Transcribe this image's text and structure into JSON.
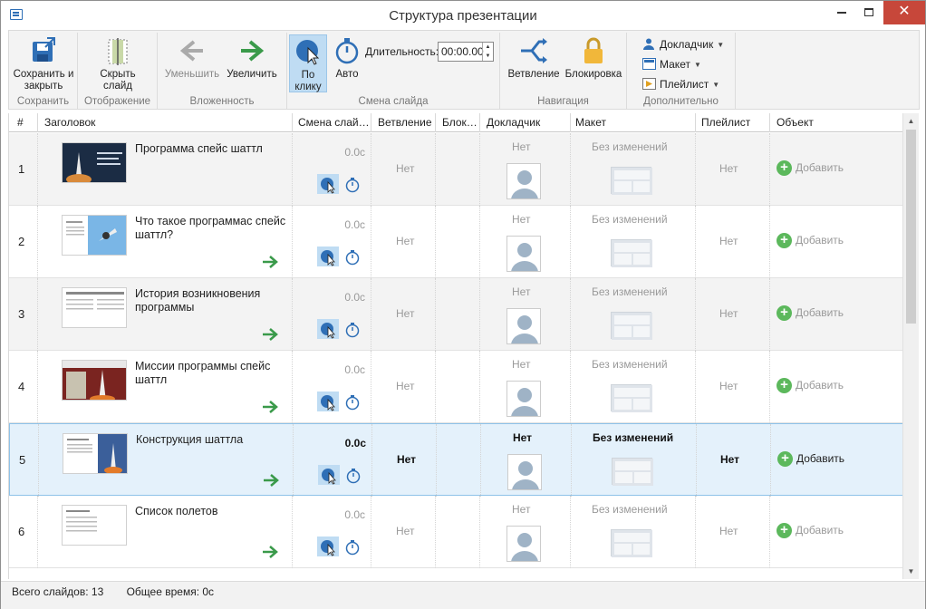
{
  "window": {
    "title": "Структура презентации"
  },
  "ribbon": {
    "groups": [
      {
        "label": "Сохранить",
        "buttons": [
          {
            "label": "Сохранить и закрыть"
          }
        ]
      },
      {
        "label": "Отображение",
        "buttons": [
          {
            "label": "Скрыть слайд"
          }
        ]
      },
      {
        "label": "Вложенность",
        "buttons": [
          {
            "label": "Уменьшить"
          },
          {
            "label": "Увеличить"
          }
        ]
      },
      {
        "label": "Смена слайда",
        "buttons": [
          {
            "label": "По клику"
          },
          {
            "label": "Авто"
          }
        ]
      },
      {
        "label": "Навигация",
        "buttons": [
          {
            "label": "Ветвление"
          },
          {
            "label": "Блокировка"
          }
        ]
      },
      {
        "label": "Дополнительно",
        "buttons": [
          {
            "label": "Докладчик"
          },
          {
            "label": "Макет"
          },
          {
            "label": "Плейлист"
          }
        ]
      }
    ],
    "duration": {
      "label": "Длительность:",
      "value": "00:00.00"
    }
  },
  "table": {
    "columns": [
      "#",
      "Заголовок",
      "Смена слайда",
      "Ветвление",
      "Блокировка",
      "Докладчик",
      "Макет",
      "Плейлист",
      "Объект"
    ],
    "columns_display": [
      "#",
      "Заголовок",
      "Смена слай…",
      "Ветвление",
      "Блок…",
      "Докладчик",
      "Макет",
      "Плейлист",
      "Объект"
    ],
    "rows": [
      {
        "num": "1",
        "title": "Программа спейс шаттл",
        "time": "0.0c",
        "branch": "Нет",
        "presenter": "Нет",
        "layout": "Без изменений",
        "playlist": "Нет",
        "object": "Добавить",
        "indent_arrow": false,
        "selected": false
      },
      {
        "num": "2",
        "title": "Что такое программас спейс шаттл?",
        "time": "0.0c",
        "branch": "Нет",
        "presenter": "Нет",
        "layout": "Без изменений",
        "playlist": "Нет",
        "object": "Добавить",
        "indent_arrow": true,
        "selected": false
      },
      {
        "num": "3",
        "title": "История возникновения программы",
        "time": "0.0c",
        "branch": "Нет",
        "presenter": "Нет",
        "layout": "Без изменений",
        "playlist": "Нет",
        "object": "Добавить",
        "indent_arrow": true,
        "selected": false
      },
      {
        "num": "4",
        "title": "Миссии программы спейс шаттл",
        "time": "0.0c",
        "branch": "Нет",
        "presenter": "Нет",
        "layout": "Без изменений",
        "playlist": "Нет",
        "object": "Добавить",
        "indent_arrow": true,
        "selected": false
      },
      {
        "num": "5",
        "title": "Конструкция шаттла",
        "time": "0.0c",
        "branch": "Нет",
        "presenter": "Нет",
        "layout": "Без изменений",
        "playlist": "Нет",
        "object": "Добавить",
        "indent_arrow": true,
        "selected": true
      },
      {
        "num": "6",
        "title": "Список полетов",
        "time": "0.0c",
        "branch": "Нет",
        "presenter": "Нет",
        "layout": "Без изменений",
        "playlist": "Нет",
        "object": "Добавить",
        "indent_arrow": true,
        "selected": false
      }
    ]
  },
  "status": {
    "total_slides": "Всего слайдов: 13",
    "total_time": "Общее время:  0с"
  },
  "colors": {
    "accent": "#2f6fb6",
    "selected_row": "#e4f1fb",
    "add_green": "#5cb85c",
    "close_red": "#c7473a"
  }
}
